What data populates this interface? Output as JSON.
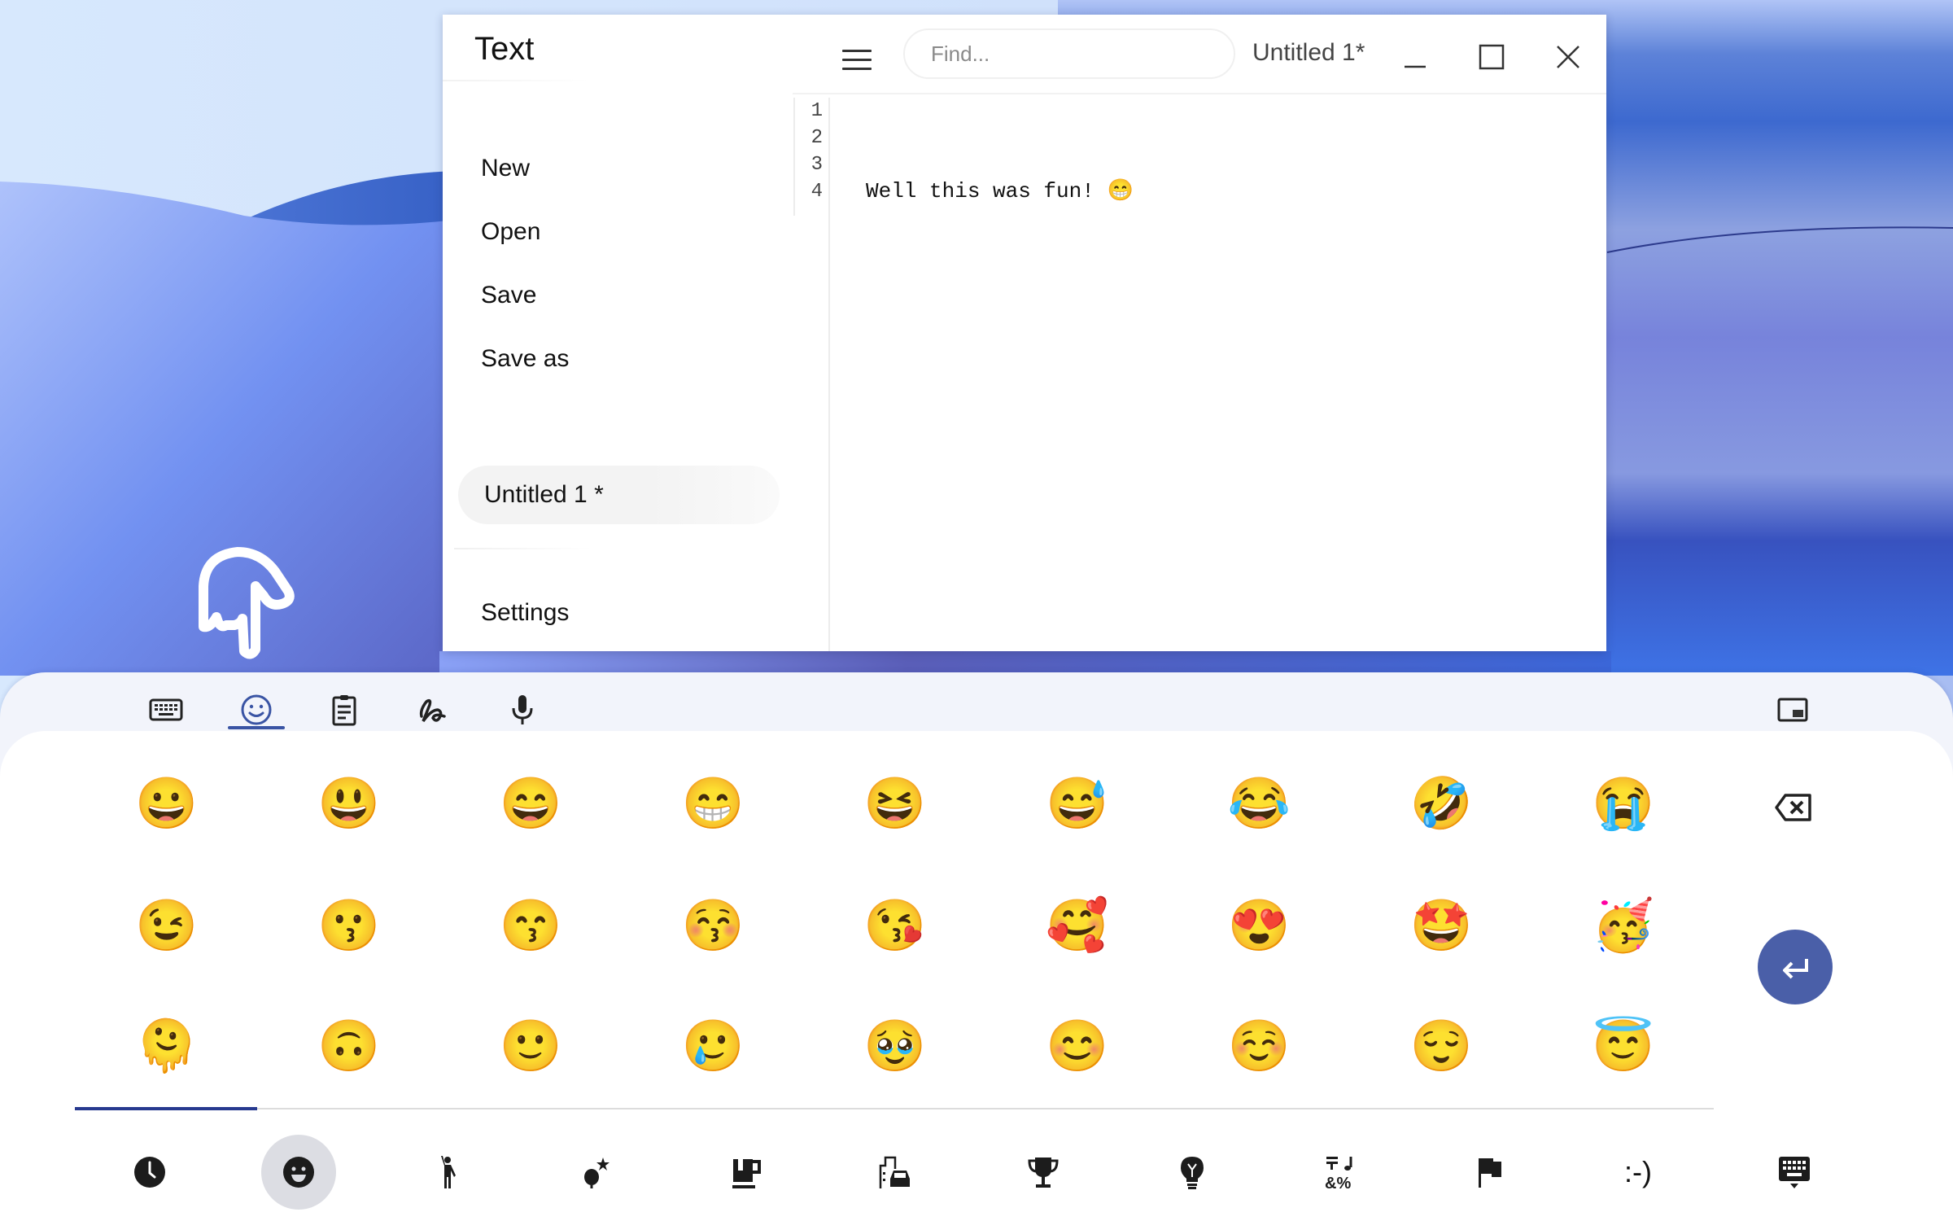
{
  "app": {
    "title": "Text",
    "document_title": "Untitled 1*",
    "find_placeholder": "Find...",
    "find_value": ""
  },
  "window_controls": {
    "minimize": "minimize-icon",
    "maximize": "maximize-icon",
    "close": "close-icon"
  },
  "sidebar": {
    "items": [
      {
        "label": "New"
      },
      {
        "label": "Open"
      },
      {
        "label": "Save"
      },
      {
        "label": "Save as"
      }
    ],
    "open_documents": [
      {
        "label": "Untitled 1 *",
        "active": true
      }
    ],
    "settings_label": "Settings"
  },
  "editor": {
    "line_numbers": [
      "1",
      "2",
      "3",
      "4"
    ],
    "lines": [
      "",
      "",
      "",
      "Well this was fun! "
    ],
    "line4_emoji": "😁"
  },
  "keyboard": {
    "toolbar": [
      {
        "name": "keyboard",
        "icon": "keyboard-icon",
        "active": false
      },
      {
        "name": "emoji",
        "icon": "emoji-icon",
        "active": true
      },
      {
        "name": "clipboard",
        "icon": "clipboard-icon",
        "active": false
      },
      {
        "name": "handwriting",
        "icon": "handwriting-icon",
        "active": false
      },
      {
        "name": "voice",
        "icon": "microphone-icon",
        "active": false
      }
    ],
    "float_toggle": "floating-keyboard-icon",
    "emoji_rows": [
      [
        "😀",
        "😃",
        "😄",
        "😁",
        "😆",
        "😅",
        "😂",
        "🤣",
        "😭"
      ],
      [
        "😉",
        "😗",
        "😙",
        "😚",
        "😘",
        "🥰",
        "😍",
        "🤩",
        "🥳"
      ],
      [
        "🫠",
        "🙃",
        "🙂",
        "🥲",
        "🥹",
        "😊",
        "☺️",
        "😌",
        "😇"
      ]
    ],
    "backspace": "backspace-icon",
    "enter": "enter-icon",
    "categories": [
      {
        "name": "recent",
        "icon": "clock-icon",
        "active": false
      },
      {
        "name": "smileys",
        "icon": "smiley-icon",
        "active": true
      },
      {
        "name": "people",
        "icon": "person-icon",
        "active": false
      },
      {
        "name": "animals-nature",
        "icon": "flower-icon",
        "active": false
      },
      {
        "name": "food-drink",
        "icon": "mug-icon",
        "active": false
      },
      {
        "name": "travel-places",
        "icon": "building-car-icon",
        "active": false
      },
      {
        "name": "activities",
        "icon": "trophy-icon",
        "active": false
      },
      {
        "name": "objects",
        "icon": "lightbulb-icon",
        "active": false
      },
      {
        "name": "symbols",
        "icon": "symbols-icon",
        "active": false
      },
      {
        "name": "flags",
        "icon": "flag-icon",
        "active": false
      },
      {
        "name": "emoticons",
        "icon": "emoticon-icon",
        "label": ":-)",
        "active": false
      },
      {
        "name": "hide-keyboard",
        "icon": "keyboard-hide-icon",
        "active": false
      }
    ]
  },
  "colors": {
    "accent": "#3a54a4",
    "enter_button": "#4a5fa8",
    "category_active_bg": "#dcdde3"
  }
}
